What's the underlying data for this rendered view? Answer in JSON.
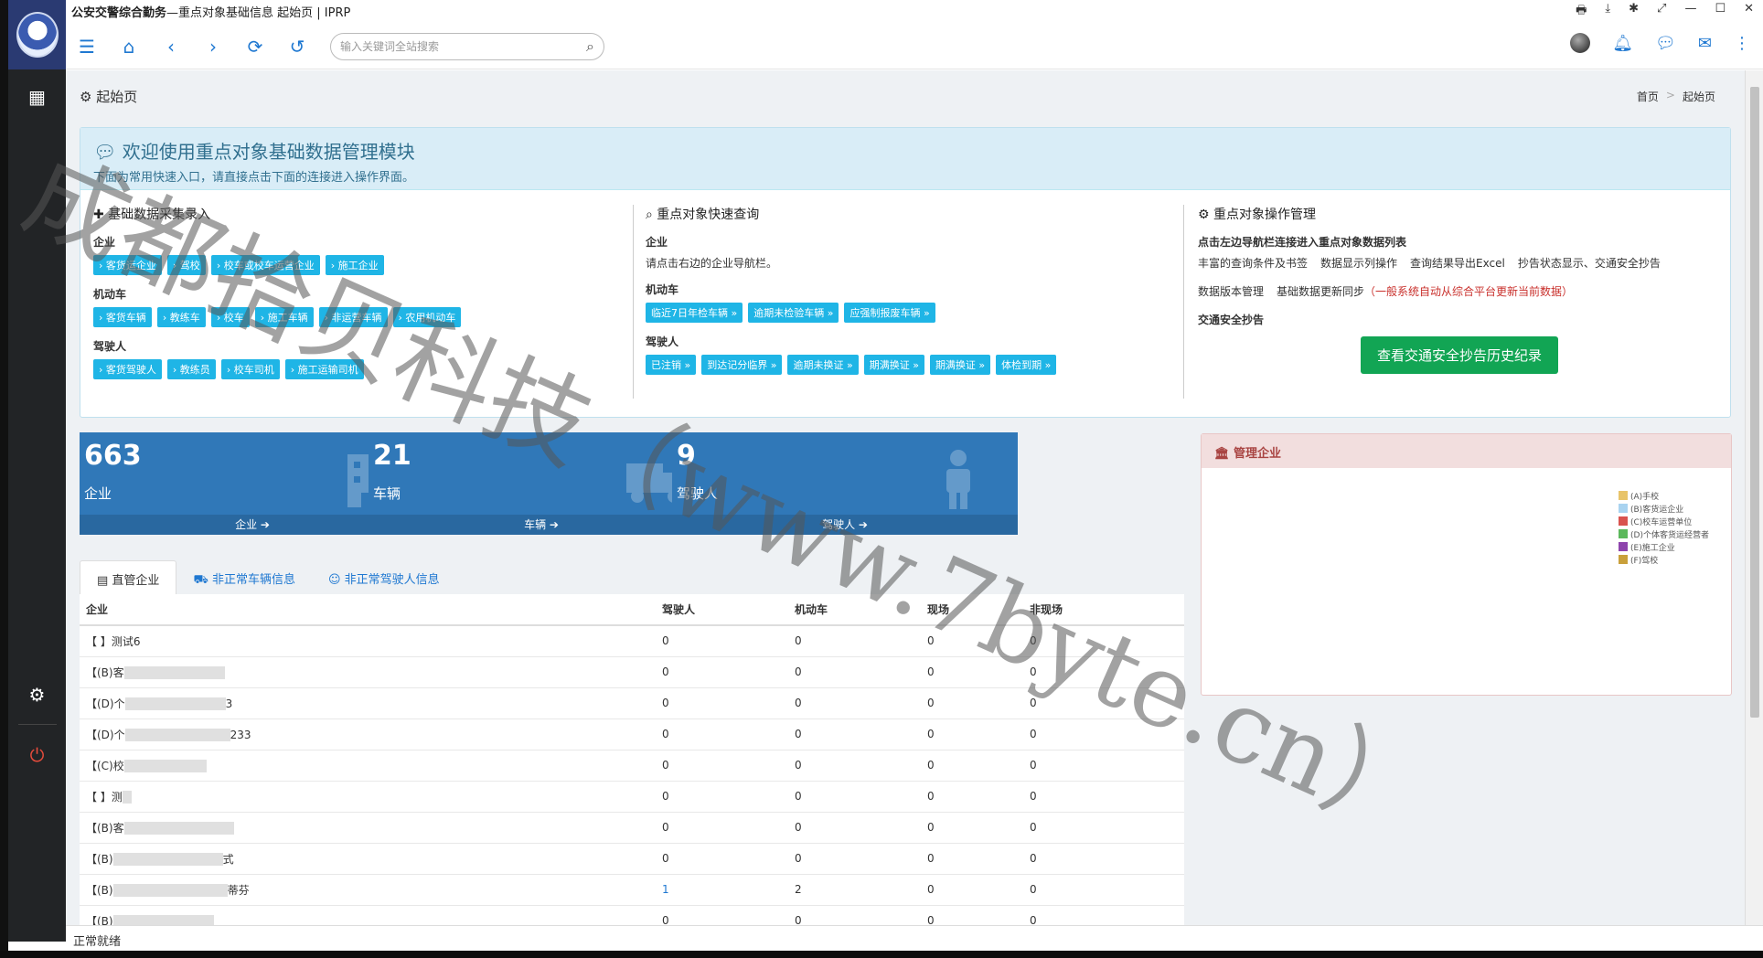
{
  "window": {
    "app_name": "公安交警综合勤务",
    "title_rest": "—重点对象基础信息 起始页 | IPRP",
    "controls": [
      "🖶",
      "⤓",
      "✱",
      "⤢",
      "—",
      "☐",
      "✕"
    ]
  },
  "search": {
    "placeholder": "输入关键词全站搜索"
  },
  "page": {
    "title": "起始页"
  },
  "breadcrumb": {
    "home": "首页",
    "sep": ">",
    "current": "起始页"
  },
  "welcome": {
    "heading": "欢迎使用重点对象基础数据管理模块",
    "sub": "下面为常用快速入口，请直接点击下面的连接进入操作界面。",
    "col1": {
      "title": "基础数据采集录入",
      "cat1": "企业",
      "chips1": [
        "› 客货运企业",
        "› 驾校",
        "› 校车或校车运营企业",
        "› 施工企业"
      ],
      "cat2": "机动车",
      "chips2": [
        "› 客货车辆",
        "› 教练车",
        "› 校车",
        "› 施工车辆",
        "› 非运营车辆",
        "› 农用机动车"
      ],
      "cat3": "驾驶人",
      "chips3": [
        "› 客货驾驶人",
        "› 教练员",
        "› 校车司机",
        "› 施工运输司机"
      ]
    },
    "col2": {
      "title": "重点对象快速查询",
      "cat1": "企业",
      "text1": "请点击右边的企业导航栏。",
      "cat2": "机动车",
      "chips2": [
        "临近7日年检车辆 »",
        "逾期未检验车辆 »",
        "应强制报废车辆 »"
      ],
      "cat3": "驾驶人",
      "chips3": [
        "已注销 »",
        "到达记分临界 »",
        "逾期未换证 »",
        "期满换证 »",
        "期满换证 »",
        "体检到期 »"
      ]
    },
    "col3": {
      "title": "重点对象操作管理",
      "bold1": "点击左边导航栏连接进入重点对象数据列表",
      "features": [
        "丰富的查询条件及书签",
        "数据显示列操作",
        "查询结果导出Excel",
        "抄告状态显示、交通安全抄告"
      ],
      "row2a": "数据版本管理",
      "row2b": "基础数据更新同步",
      "row2c": "（一般系统自动从综合平台更新当前数据）",
      "bold2": "交通安全抄告",
      "button": "查看交通安全抄告历史纪录"
    }
  },
  "stats": [
    {
      "num": "663",
      "label": "企业",
      "foot": "企业 ➔"
    },
    {
      "num": "21",
      "label": "车辆",
      "foot": "车辆 ➔"
    },
    {
      "num": "9",
      "label": "驾驶人",
      "foot": "驾驶人 ➔"
    }
  ],
  "manage": {
    "title": "管理企业",
    "legend": [
      {
        "label": "(A)手校",
        "color": "#e8c46a"
      },
      {
        "label": "(B)客货运企业",
        "color": "#a9d3f0"
      },
      {
        "label": "(C)校车运营单位",
        "color": "#d9534f"
      },
      {
        "label": "(D)个体客货运经营者",
        "color": "#5cb85c"
      },
      {
        "label": "(E)施工企业",
        "color": "#8e44ad"
      },
      {
        "label": "(F)驾校",
        "color": "#c9a03b"
      }
    ]
  },
  "tabs": [
    "直管企业",
    "非正常车辆信息",
    "非正常驾驶人信息"
  ],
  "table": {
    "headers": [
      "企业",
      "驾驶人",
      "机动车",
      "现场",
      "非现场"
    ],
    "rows": [
      [
        "【 】测试6",
        "0",
        "0",
        "0",
        "0"
      ],
      [
        "【(B)客",
        "0",
        "0",
        "0",
        "0"
      ],
      [
        "【(D)个",
        "0",
        "0",
        "0",
        "0"
      ],
      [
        "【(D)个",
        "0",
        "0",
        "0",
        "0"
      ],
      [
        "【(C)校",
        "0",
        "0",
        "0",
        "0"
      ],
      [
        "【 】测",
        "0",
        "0",
        "0",
        "0"
      ],
      [
        "【(B)客",
        "0",
        "0",
        "0",
        "0"
      ],
      [
        "【(B)",
        "0",
        "0",
        "0",
        "0"
      ],
      [
        "【(B)",
        "1",
        "2",
        "0",
        "0"
      ],
      [
        "【(B)",
        "0",
        "0",
        "0",
        "0"
      ]
    ],
    "row_suffixes": [
      "",
      "",
      "3",
      "233",
      "",
      "",
      "",
      "式",
      "蒂芬",
      ""
    ]
  },
  "status": {
    "text": "正常就绪"
  },
  "watermark": {
    "text": "成都拾贝科技（www.7byte.cn）"
  },
  "colors": {
    "accent": "#1f78d1",
    "stat": "#3078b8",
    "chip": "#1fb5e6",
    "green": "#12a554",
    "sidebar": "#222426"
  }
}
